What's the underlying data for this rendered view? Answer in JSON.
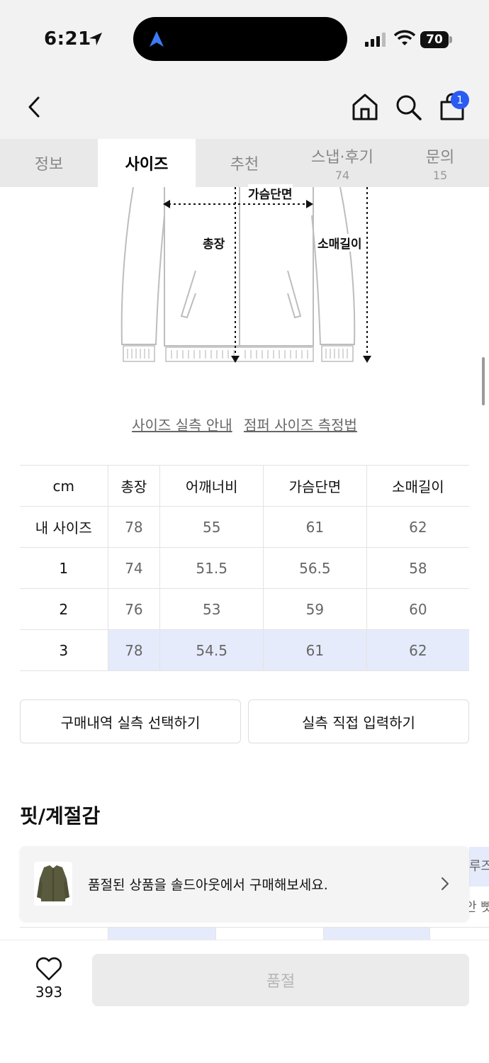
{
  "status": {
    "time": "6:21",
    "battery": "70"
  },
  "header": {
    "cart_count": "1"
  },
  "tabs": [
    {
      "label": "정보",
      "count": ""
    },
    {
      "label": "사이즈",
      "count": ""
    },
    {
      "label": "추천",
      "count": ""
    },
    {
      "label": "스냅·후기",
      "count": "74"
    },
    {
      "label": "문의",
      "count": "15"
    }
  ],
  "diagram": {
    "chest": "가슴단면",
    "length": "총장",
    "sleeve": "소매길이"
  },
  "guide": {
    "size_info": "사이즈 실측 안내",
    "measure_method": "점퍼 사이즈 측정법"
  },
  "size_table": {
    "headers": [
      "cm",
      "총장",
      "어깨너비",
      "가슴단면",
      "소매길이"
    ],
    "rows": [
      {
        "label": "내 사이즈",
        "values": [
          "78",
          "55",
          "61",
          "62"
        ]
      },
      {
        "label": "1",
        "values": [
          "74",
          "51.5",
          "56.5",
          "58"
        ]
      },
      {
        "label": "2",
        "values": [
          "76",
          "53",
          "59",
          "60"
        ]
      },
      {
        "label": "3",
        "values": [
          "78",
          "54.5",
          "61",
          "62"
        ]
      }
    ]
  },
  "actions": {
    "purchase_select": "구매내역 실측 선택하기",
    "direct_input": "실측 직접 입력하기"
  },
  "section": {
    "fit_title": "핏/계절감"
  },
  "peek": {
    "row1": "루즈",
    "row2": "안 빳"
  },
  "soldout": {
    "message": "품절된 상품을 솔드아웃에서 구매해보세요."
  },
  "bottom": {
    "likes": "393",
    "buy_label": "품절"
  },
  "colors": {
    "accent": "#2a5cf3",
    "highlight": "#e6ebfb"
  }
}
